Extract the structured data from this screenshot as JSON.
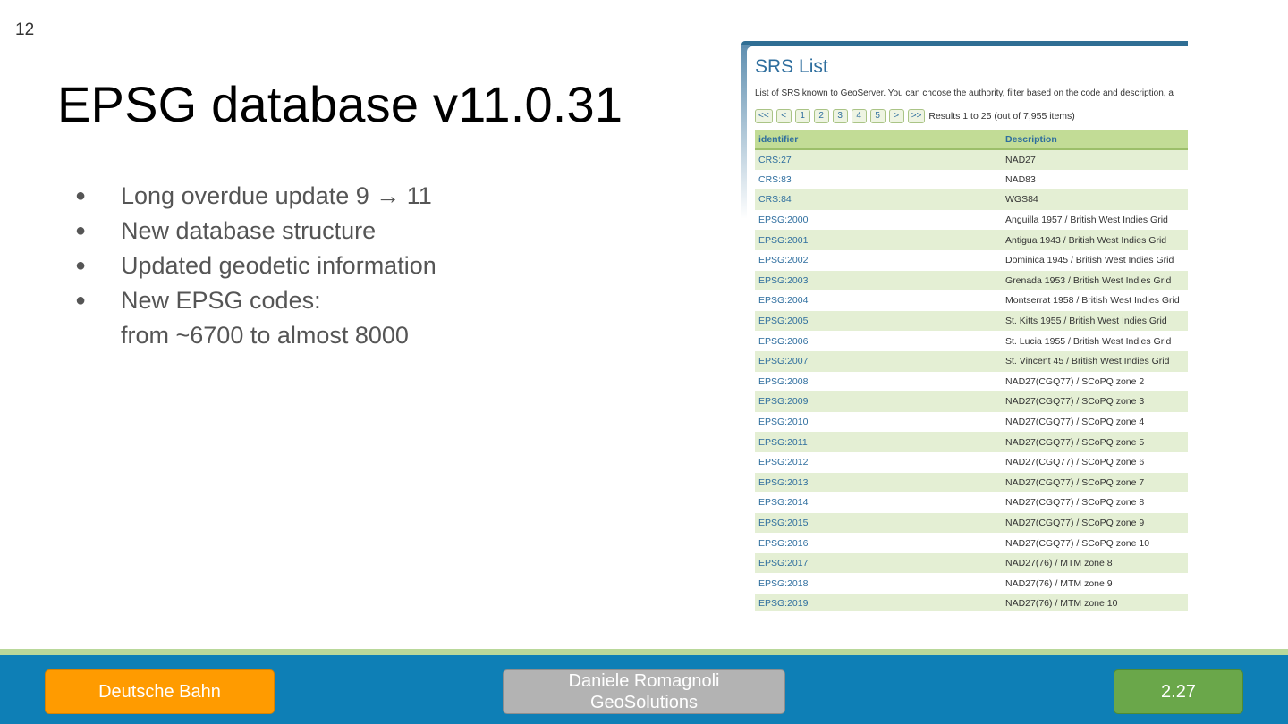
{
  "slide": {
    "number": "12",
    "title": "EPSG database v11.0.31",
    "bullets": [
      {
        "text": "Long overdue update 9 → 11"
      },
      {
        "text": "New database structure"
      },
      {
        "text": "Updated geodetic information"
      },
      {
        "text": "New EPSG codes:",
        "continuation": "from ~6700 to almost 8000"
      }
    ]
  },
  "screenshot": {
    "title": "SRS List",
    "description": "List of SRS known to GeoServer. You can choose the authority, filter based on the code and description, a",
    "pager": {
      "first": "<<",
      "prev": "<",
      "pages": [
        "1",
        "2",
        "3",
        "4",
        "5"
      ],
      "next": ">",
      "last": ">>",
      "result_text": "Results 1 to 25 (out of 7,955 items)"
    },
    "table": {
      "columns": [
        "identifier",
        "Description"
      ],
      "rows": [
        [
          "CRS:27",
          "NAD27"
        ],
        [
          "CRS:83",
          "NAD83"
        ],
        [
          "CRS:84",
          "WGS84"
        ],
        [
          "EPSG:2000",
          "Anguilla 1957 / British West Indies Grid"
        ],
        [
          "EPSG:2001",
          "Antigua 1943 / British West Indies Grid"
        ],
        [
          "EPSG:2002",
          "Dominica 1945 / British West Indies Grid"
        ],
        [
          "EPSG:2003",
          "Grenada 1953 / British West Indies Grid"
        ],
        [
          "EPSG:2004",
          "Montserrat 1958 / British West Indies Grid"
        ],
        [
          "EPSG:2005",
          "St. Kitts 1955 / British West Indies Grid"
        ],
        [
          "EPSG:2006",
          "St. Lucia 1955 / British West Indies Grid"
        ],
        [
          "EPSG:2007",
          "St. Vincent 45 / British West Indies Grid"
        ],
        [
          "EPSG:2008",
          "NAD27(CGQ77) / SCoPQ zone 2"
        ],
        [
          "EPSG:2009",
          "NAD27(CGQ77) / SCoPQ zone 3"
        ],
        [
          "EPSG:2010",
          "NAD27(CGQ77) / SCoPQ zone 4"
        ],
        [
          "EPSG:2011",
          "NAD27(CGQ77) / SCoPQ zone 5"
        ],
        [
          "EPSG:2012",
          "NAD27(CGQ77) / SCoPQ zone 6"
        ],
        [
          "EPSG:2013",
          "NAD27(CGQ77) / SCoPQ zone 7"
        ],
        [
          "EPSG:2014",
          "NAD27(CGQ77) / SCoPQ zone 8"
        ],
        [
          "EPSG:2015",
          "NAD27(CGQ77) / SCoPQ zone 9"
        ],
        [
          "EPSG:2016",
          "NAD27(CGQ77) / SCoPQ zone 10"
        ],
        [
          "EPSG:2017",
          "NAD27(76) / MTM zone 8"
        ],
        [
          "EPSG:2018",
          "NAD27(76) / MTM zone 9"
        ],
        [
          "EPSG:2019",
          "NAD27(76) / MTM zone 10"
        ]
      ]
    }
  },
  "footer": {
    "company": "Deutsche Bahn",
    "author_line1": "Daniele Romagnoli",
    "author_line2": "GeoSolutions",
    "version": "2.27"
  },
  "colors": {
    "footer_bg": "#0e7fb6",
    "footer_line": "#b9d89a",
    "company_pill": "#ff9b00",
    "author_pill": "#b3b3b3",
    "version_pill": "#6aa74a",
    "table_header": "#c2dc96",
    "table_stripe": "#e4efd4",
    "link": "#2e6e9e"
  }
}
